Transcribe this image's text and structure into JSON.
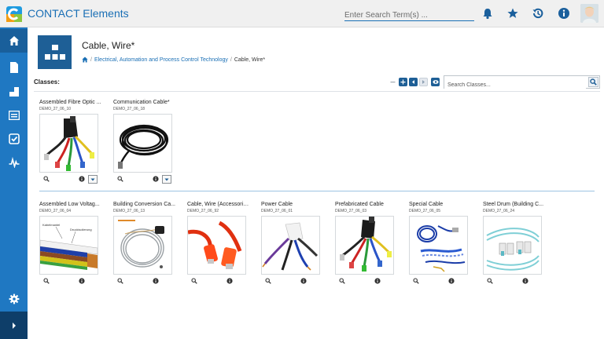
{
  "app": {
    "title": "CONTACT Elements"
  },
  "header_search": {
    "placeholder": "Enter Search Term(s) ..."
  },
  "page": {
    "title": "Cable, Wire*",
    "breadcrumb": [
      "Electrical, Automation and Process Control Technology",
      "Cable, Wire*"
    ]
  },
  "classes": {
    "label": "Classes:",
    "search_placeholder": "Search Classes..."
  },
  "top_cards": [
    {
      "name": "Assembled Fibre Optic ...",
      "code": "DEMO_27_06_10",
      "image": "multicolor-connector-cable"
    },
    {
      "name": "Communication Cable*",
      "code": "DEMO_27_06_18",
      "image": "black-coiled-cable"
    }
  ],
  "bottom_cards": [
    {
      "name": "Assembled Low Voltag...",
      "code": "DEMO_27_06_04",
      "image": "wire-cross-section"
    },
    {
      "name": "Building Conversion Ca...",
      "code": "DEMO_27_06_13",
      "image": "grey-cable-coil"
    },
    {
      "name": "Cable, Wire (Accessories)",
      "code": "DEMO_27_06_92",
      "image": "red-usb-cable"
    },
    {
      "name": "Power Cable",
      "code": "DEMO_27_06_01",
      "image": "stripped-power-cable"
    },
    {
      "name": "Prefabricated Cable",
      "code": "DEMO_27_06_03",
      "image": "multicolor-connector-cable"
    },
    {
      "name": "Special Cable",
      "code": "DEMO_27_06_05",
      "image": "blue-network-cables"
    },
    {
      "name": "Steel Drum (Building C...",
      "code": "DEMO_27_06_24",
      "image": "fibre-optic-patch"
    }
  ],
  "wire_labels": {
    "sheath": "Kabelmantel",
    "insulation": "Druckisolierung"
  },
  "colors": {
    "brand_blue": "#1f78c2",
    "sidebar_dark": "#0e3e69",
    "header_icon_bg": "#1e5f96"
  }
}
